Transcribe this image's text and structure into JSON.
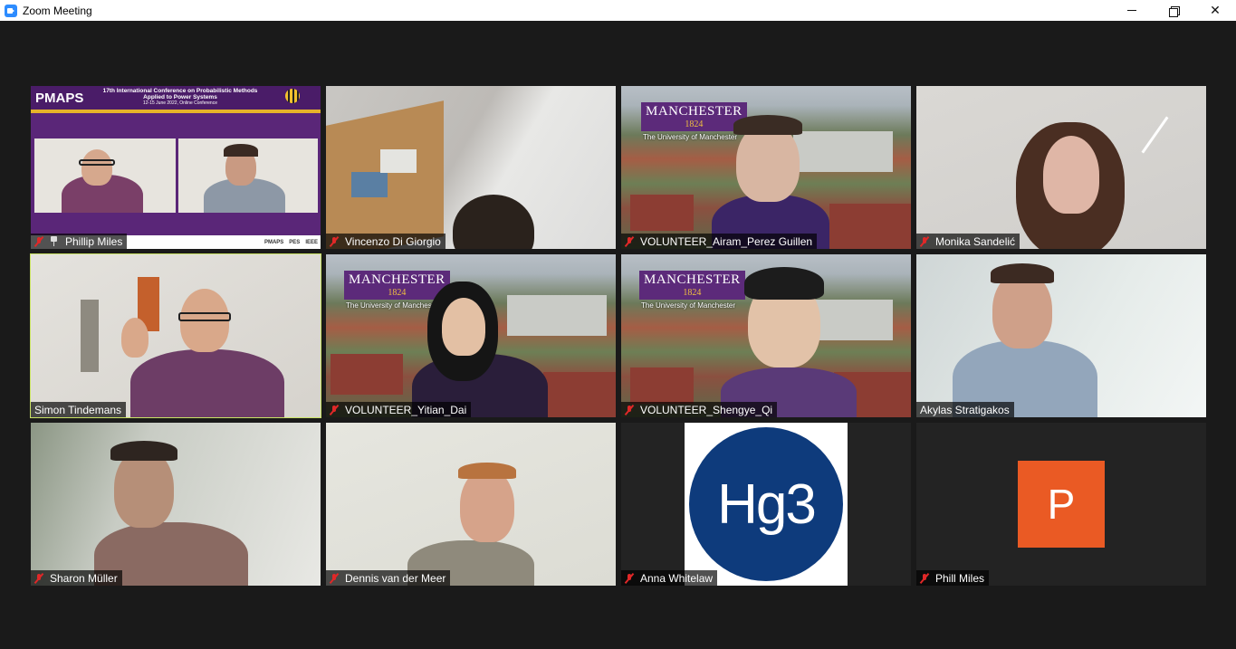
{
  "window": {
    "title": "Zoom Meeting",
    "controls": {
      "minimize": "minimize",
      "maximize": "restore",
      "close": "close"
    }
  },
  "colors": {
    "background": "#1a1a1a",
    "active_speaker_outline": "#c9e265",
    "muted_mic": "#e02828",
    "avatar_bg": "#ea5a24",
    "hg3_blue": "#0e3b7c",
    "manchester_purple": "#5c2a7a"
  },
  "shared_slide": {
    "logo": "PMAPS",
    "conference_line1": "17th International Conference on Probabilistic Methods",
    "conference_line2": "Applied to Power Systems",
    "conference_dates": "12-15 June 2022, Online Conference",
    "footer_logos": [
      "PMAPS",
      "PES",
      "IEEE"
    ]
  },
  "manchester_background": {
    "line1": "MANCHESTER",
    "line2": "1824",
    "line3": "The University of Manchester"
  },
  "logo_tile": {
    "text": "Hg3"
  },
  "avatar_tile": {
    "initial": "P"
  },
  "participants": [
    {
      "name": "Phillip Miles",
      "muted": true,
      "pinned": true,
      "video": "shared-screen"
    },
    {
      "name": "Vincenzo Di Giorgio",
      "muted": true,
      "video": "camera"
    },
    {
      "name": "VOLUNTEER_Airam_Perez Guillen",
      "muted": true,
      "video": "virtual-background"
    },
    {
      "name": "Monika Sandelić",
      "muted": true,
      "video": "camera"
    },
    {
      "name": "Simon Tindemans",
      "muted": false,
      "active_speaker": true,
      "video": "camera"
    },
    {
      "name": "VOLUNTEER_Yitian_Dai",
      "muted": true,
      "video": "virtual-background"
    },
    {
      "name": "VOLUNTEER_Shengye_Qi",
      "muted": true,
      "video": "virtual-background"
    },
    {
      "name": "Akylas Stratigakos",
      "muted": false,
      "video": "camera"
    },
    {
      "name": "Sharon Müller",
      "muted": true,
      "video": "camera"
    },
    {
      "name": "Dennis van der Meer",
      "muted": true,
      "video": "camera"
    },
    {
      "name": "Anna Whitelaw",
      "muted": true,
      "video": "logo"
    },
    {
      "name": "Phill Miles",
      "muted": true,
      "video": "avatar"
    }
  ]
}
